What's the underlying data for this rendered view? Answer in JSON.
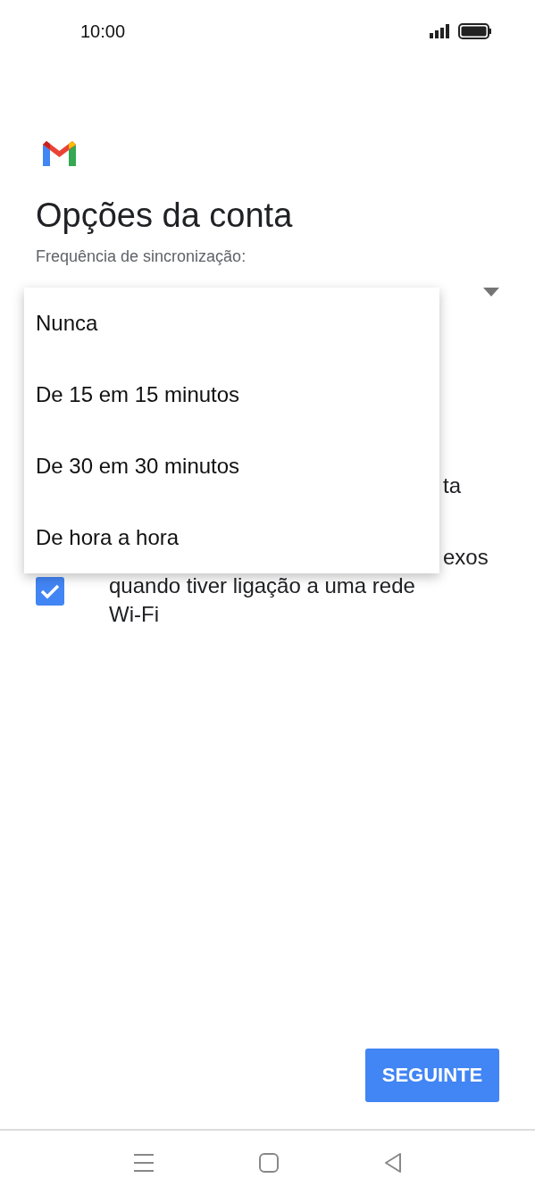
{
  "status_bar": {
    "time": "10:00"
  },
  "title": "Opções da conta",
  "sync_frequency": {
    "label": "Frequência de sincronização:",
    "options": [
      {
        "label": "Nunca"
      },
      {
        "label": "De 15 em 15 minutos"
      },
      {
        "label": "De 30 em 30 minutos"
      },
      {
        "label": "De hora a hora"
      }
    ]
  },
  "settings": [
    {
      "kind": "text",
      "fragment": "ta"
    },
    {
      "kind": "checkbox",
      "fragment": "exos",
      "text": "quando tiver ligação a uma rede Wi-Fi",
      "checked": true
    }
  ],
  "next_button": "SEGUINTE"
}
